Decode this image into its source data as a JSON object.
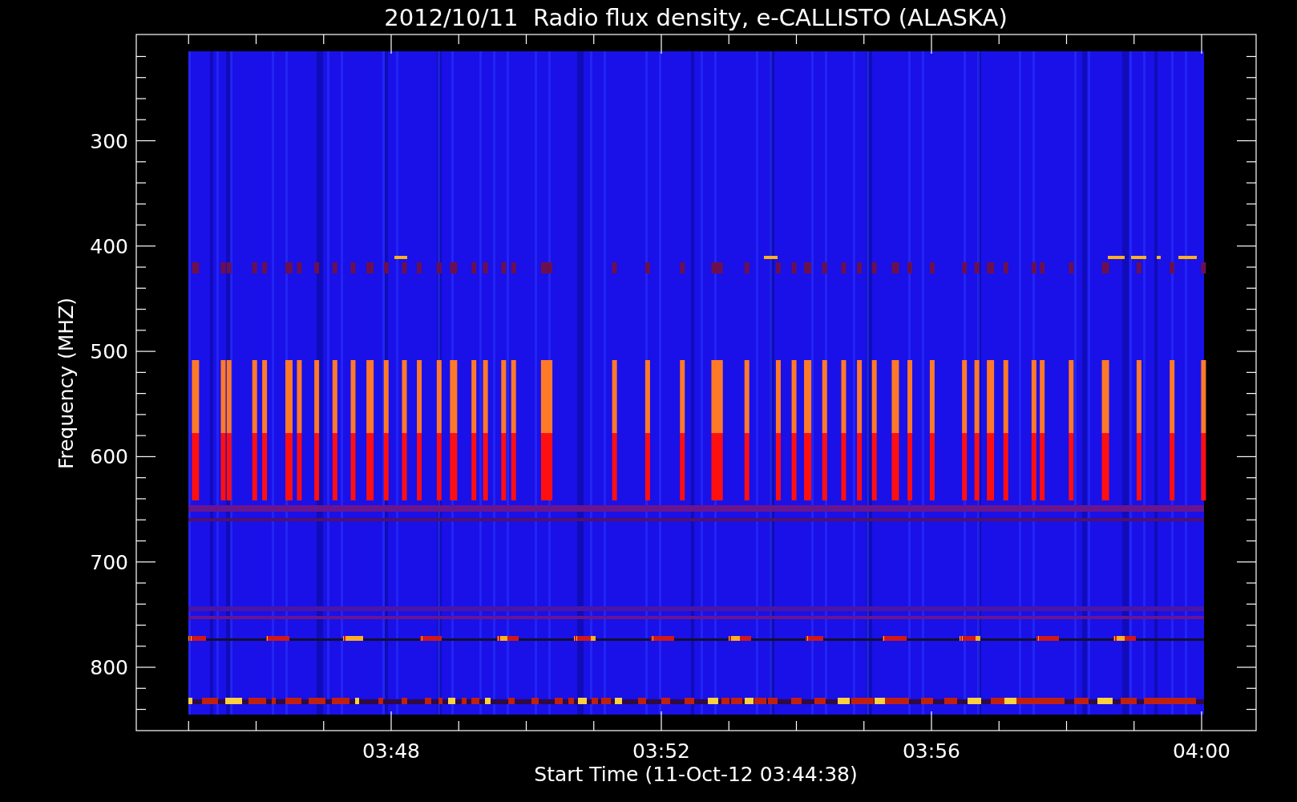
{
  "title": "2012/10/11  Radio flux density, e-CALLISTO (ALASKA)",
  "y_axis": {
    "label": "Frequency (MHZ)",
    "ticks": [
      "300",
      "400",
      "500",
      "600",
      "700",
      "800"
    ]
  },
  "x_axis": {
    "label": "Start Time (11-Oct-12 03:44:38)",
    "ticks": [
      "03:48",
      "03:52",
      "03:56",
      "04:00"
    ]
  }
}
